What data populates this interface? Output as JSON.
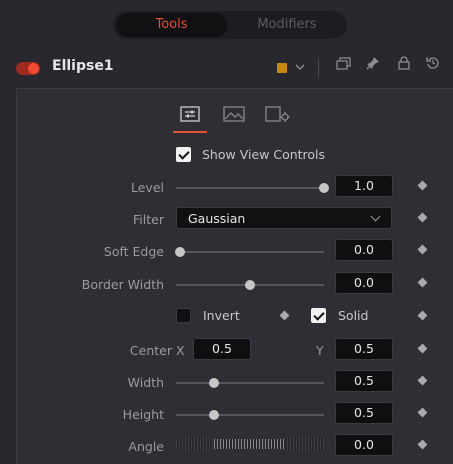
{
  "top_tabs": {
    "tools": "Tools",
    "modifiers": "Modifiers"
  },
  "header": {
    "node_name": "Ellipse1",
    "color_swatch": "#c98a12",
    "icons": [
      "color-picker-chevron-icon",
      "windows-icon",
      "pin-icon",
      "lock-icon",
      "reset-icon"
    ]
  },
  "panel_tabs": [
    "controls-icon",
    "image-icon",
    "settings-icon"
  ],
  "show_view_controls": {
    "label": "Show View Controls",
    "checked": true
  },
  "controls": {
    "level": {
      "label": "Level",
      "value": "1.0",
      "slider": 1.0
    },
    "filter": {
      "label": "Filter",
      "value": "Gaussian"
    },
    "soft_edge": {
      "label": "Soft Edge",
      "value": "0.0",
      "slider": 0.0
    },
    "border_width": {
      "label": "Border Width",
      "value": "0.0",
      "slider": 0.5
    },
    "invert": {
      "label": "Invert",
      "checked": false
    },
    "solid": {
      "label": "Solid",
      "checked": true
    },
    "center": {
      "label": "Center",
      "x_label": "X",
      "x_value": "0.5",
      "y_label": "Y",
      "y_value": "0.5"
    },
    "width": {
      "label": "Width",
      "value": "0.5",
      "slider": 0.25
    },
    "height": {
      "label": "Height",
      "value": "0.5",
      "slider": 0.25
    },
    "angle": {
      "label": "Angle",
      "value": "0.0"
    }
  },
  "colors": {
    "accent": "#e0503b",
    "panel": "#2e2e34",
    "background": "#28282e"
  }
}
